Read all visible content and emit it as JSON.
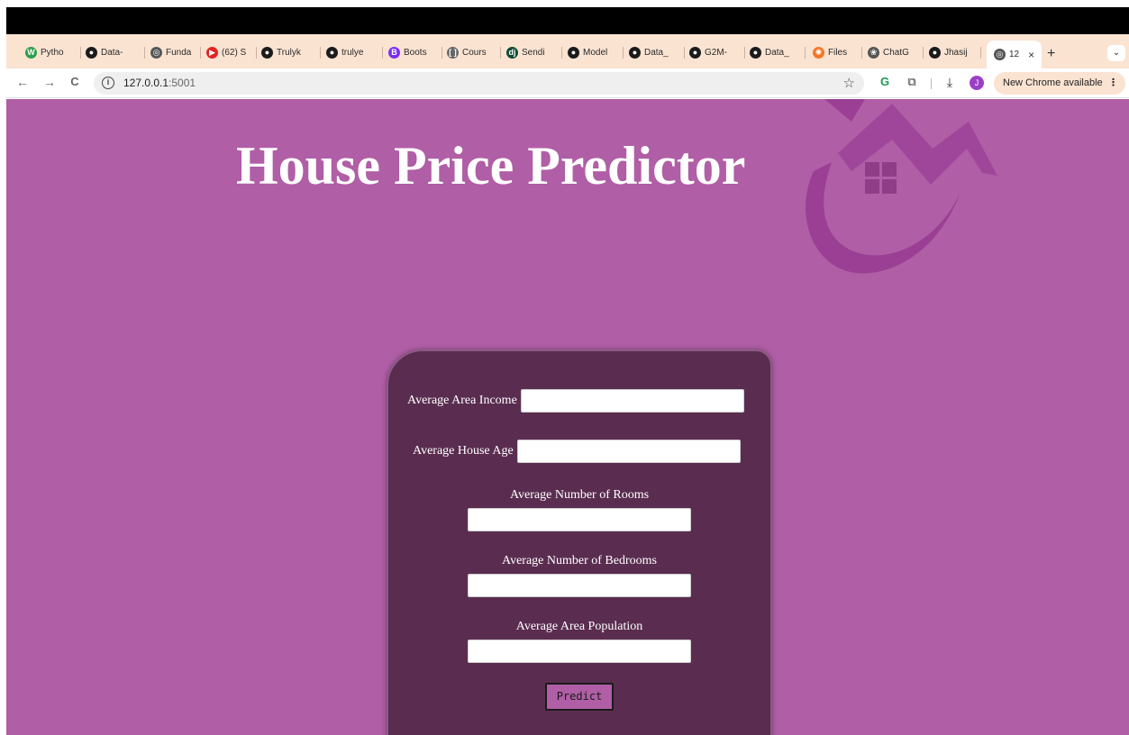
{
  "browser": {
    "tabs": [
      {
        "label": "Pytho",
        "icon": "w-letter-icon",
        "color": "#2e9d4c",
        "glyph": "W"
      },
      {
        "label": "Data-",
        "icon": "github-icon",
        "color": "#1b1b1b",
        "glyph": "●"
      },
      {
        "label": "Funda",
        "icon": "globe-icon",
        "color": "#555555",
        "glyph": "◎"
      },
      {
        "label": "(62) S",
        "icon": "youtube-icon",
        "color": "#e02424",
        "glyph": "▶"
      },
      {
        "label": "Trulyk",
        "icon": "github-icon",
        "color": "#1b1b1b",
        "glyph": "●"
      },
      {
        "label": "trulye",
        "icon": "github-icon",
        "color": "#1b1b1b",
        "glyph": "●"
      },
      {
        "label": "Boots",
        "icon": "bootstrap-icon",
        "color": "#7b2ff2",
        "glyph": "B"
      },
      {
        "label": "Cours",
        "icon": "brackets-icon",
        "color": "#666666",
        "glyph": "[ ]"
      },
      {
        "label": "Sendi",
        "icon": "django-icon",
        "color": "#0c4b33",
        "glyph": "dj"
      },
      {
        "label": "Model",
        "icon": "github-icon",
        "color": "#1b1b1b",
        "glyph": "●"
      },
      {
        "label": "Data_",
        "icon": "github-icon",
        "color": "#1b1b1b",
        "glyph": "●"
      },
      {
        "label": "G2M-",
        "icon": "github-icon",
        "color": "#1b1b1b",
        "glyph": "●"
      },
      {
        "label": "Data_",
        "icon": "github-icon",
        "color": "#1b1b1b",
        "glyph": "●"
      },
      {
        "label": "Files",
        "icon": "jupyter-icon",
        "color": "#f37726",
        "glyph": "✺"
      },
      {
        "label": "ChatG",
        "icon": "chatgpt-icon",
        "color": "#555555",
        "glyph": "❀"
      },
      {
        "label": "Jhasij",
        "icon": "github-icon",
        "color": "#1b1b1b",
        "glyph": "●"
      }
    ],
    "active_tab": {
      "label": "12",
      "icon": "globe-icon",
      "close": "×"
    },
    "new_tab": "+",
    "tab_menu": "⌄",
    "address": {
      "host": "127.0.0.1",
      "port": ":5001"
    },
    "nav": {
      "back": "←",
      "forward": "→",
      "reload": "C",
      "info": "i",
      "star": "☆"
    },
    "toolbar_icons": {
      "grammarly": "G",
      "extensions": "⧉",
      "download": "⤓"
    },
    "profile_initial": "J",
    "update_chip": "New Chrome available",
    "update_menu": "⋮"
  },
  "page": {
    "title": "House Price Predictor",
    "fields": {
      "income": "Average Area Income",
      "house_age": "Average House Age",
      "rooms": "Average Number of Rooms",
      "bedrooms": "Average Number of Bedrooms",
      "population": "Average Area Population"
    },
    "submit_label": "Predict"
  },
  "colors": {
    "page_bg": "#b05ea6",
    "card_bg": "#5a2d50",
    "logo": "#9a3f93",
    "tabstrip": "#fbe3d2"
  }
}
